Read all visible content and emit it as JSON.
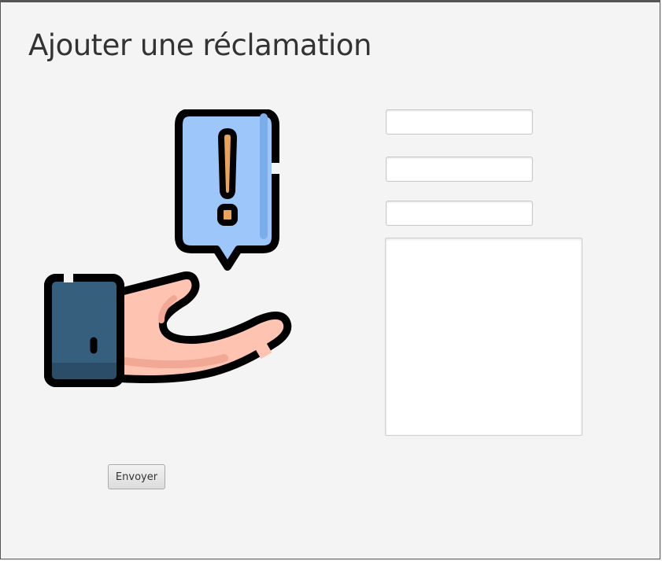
{
  "page": {
    "title": "Ajouter une réclamation"
  },
  "form": {
    "field_1": {
      "value": "",
      "placeholder": ""
    },
    "field_2": {
      "value": "",
      "placeholder": ""
    },
    "field_3": {
      "value": "",
      "placeholder": ""
    },
    "description": {
      "value": "",
      "placeholder": ""
    },
    "submit_label": "Envoyer"
  },
  "illustration": {
    "icon": "hand-with-exclamation-bubble-icon",
    "colors": {
      "bubble": "#9dc6fb",
      "exclamation": "#e9a35a",
      "sleeve": "#365e7d",
      "skin": "#ffc3b2",
      "skin_shadow": "#f1a894",
      "outline": "#000000"
    }
  },
  "colors": {
    "background": "#f4f4f4",
    "title_text": "#333333",
    "field_background": "#ffffff",
    "field_border": "#c8c8c8"
  }
}
